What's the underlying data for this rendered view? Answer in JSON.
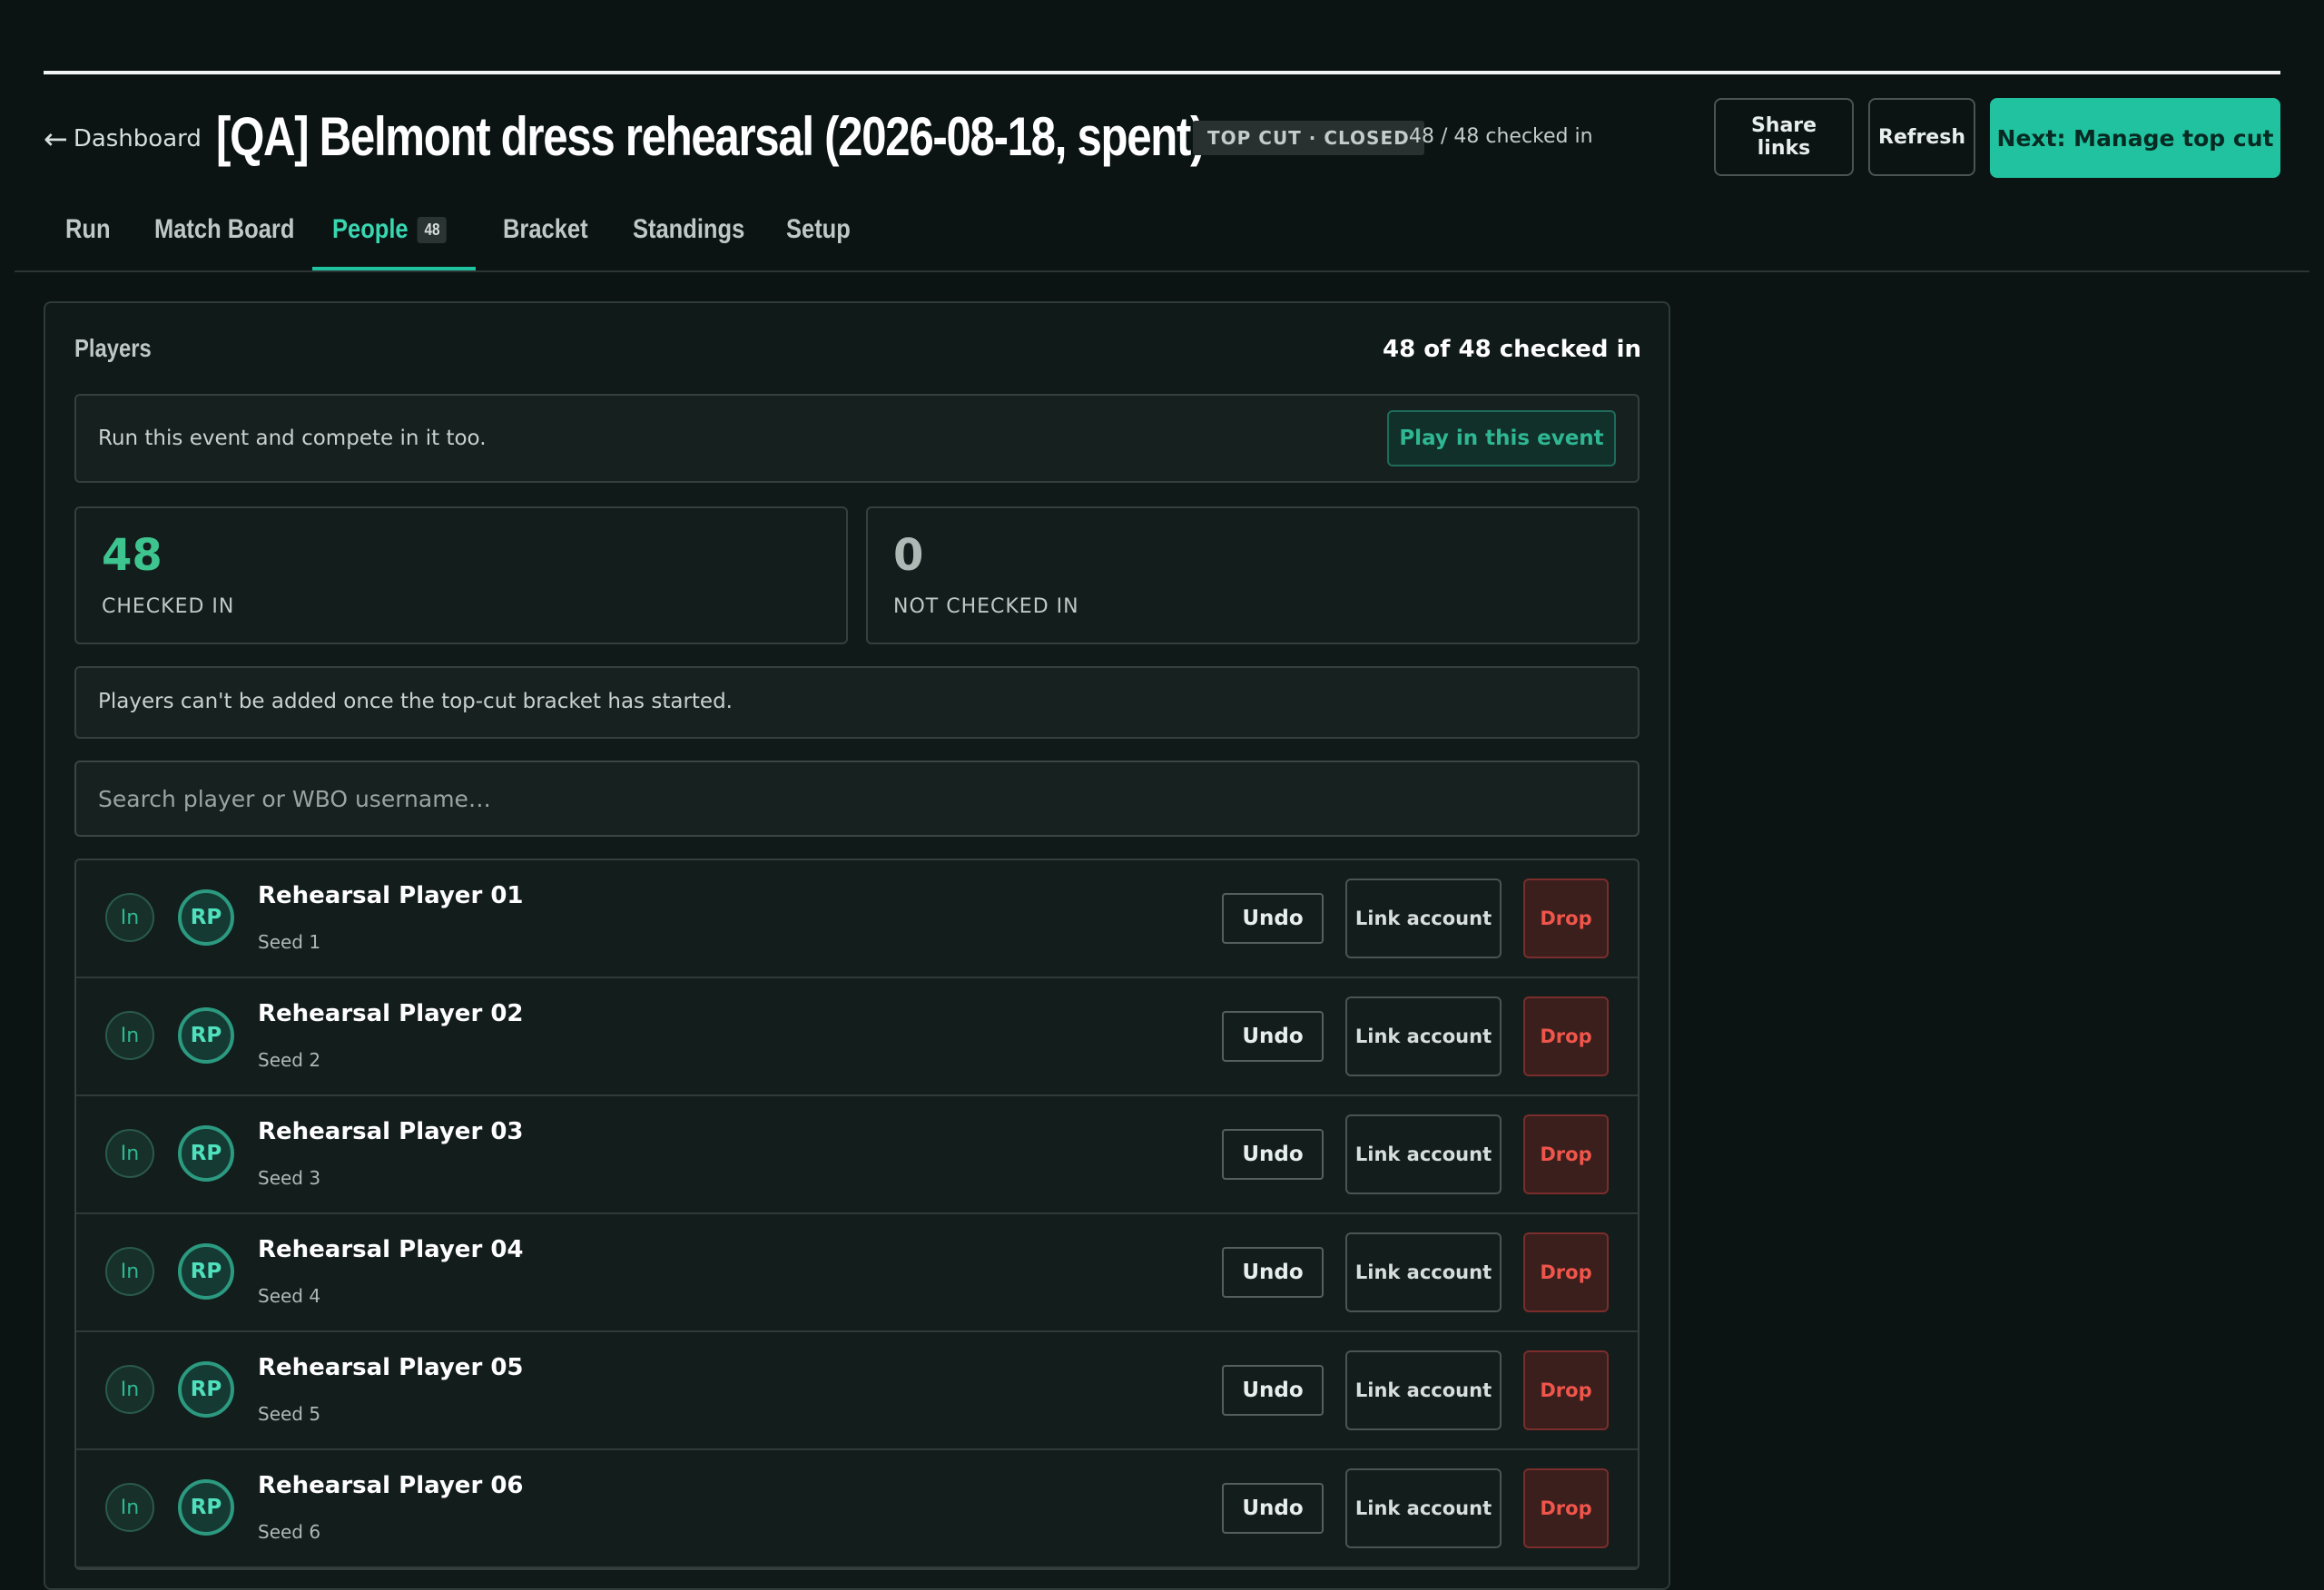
{
  "header": {
    "back_label": "Dashboard",
    "back_arrow": "←",
    "title": "[QA] Belmont dress rehearsal (2026-08-18, spent)",
    "status_badge": "TOP CUT · CLOSED",
    "checkin_summary": "48 / 48 checked in",
    "share_label": "Share links",
    "refresh_label": "Refresh",
    "next_label": "Next: Manage top cut"
  },
  "tabs": [
    {
      "label": "Run"
    },
    {
      "label": "Match Board"
    },
    {
      "label": "People",
      "count": "48",
      "active": true
    },
    {
      "label": "Bracket"
    },
    {
      "label": "Standings"
    },
    {
      "label": "Setup"
    }
  ],
  "players_panel": {
    "title": "Players",
    "count_text": "48 of 48 checked in",
    "play_text": "Run this event and compete in it too.",
    "play_button": "Play in this event",
    "checked_in": {
      "value": "48",
      "label": "CHECKED IN",
      "color": "#3ec48f"
    },
    "not_checked_in": {
      "value": "0",
      "label": "NOT CHECKED IN",
      "color": "#aeb8b5"
    },
    "notice": "Players can't be added once the top-cut bracket has started.",
    "search_placeholder": "Search player or WBO username…",
    "rows": [
      {
        "status": "In",
        "initials": "RP",
        "name": "Rehearsal Player 01",
        "seed": "Seed 1",
        "undo": "Undo",
        "link": "Link account",
        "drop": "Drop"
      },
      {
        "status": "In",
        "initials": "RP",
        "name": "Rehearsal Player 02",
        "seed": "Seed 2",
        "undo": "Undo",
        "link": "Link account",
        "drop": "Drop"
      },
      {
        "status": "In",
        "initials": "RP",
        "name": "Rehearsal Player 03",
        "seed": "Seed 3",
        "undo": "Undo",
        "link": "Link account",
        "drop": "Drop"
      },
      {
        "status": "In",
        "initials": "RP",
        "name": "Rehearsal Player 04",
        "seed": "Seed 4",
        "undo": "Undo",
        "link": "Link account",
        "drop": "Drop"
      },
      {
        "status": "In",
        "initials": "RP",
        "name": "Rehearsal Player 05",
        "seed": "Seed 5",
        "undo": "Undo",
        "link": "Link account",
        "drop": "Drop"
      },
      {
        "status": "In",
        "initials": "RP",
        "name": "Rehearsal Player 06",
        "seed": "Seed 6",
        "undo": "Undo",
        "link": "Link account",
        "drop": "Drop"
      }
    ]
  },
  "colors": {
    "background": "#0b1313",
    "accent": "#21c2a0",
    "accent_text": "#38d6b1",
    "danger": "#f0554b"
  }
}
